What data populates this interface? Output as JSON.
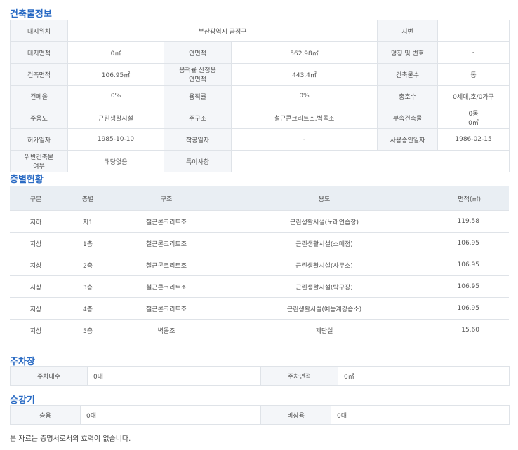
{
  "building": {
    "title": "건축물정보",
    "rows": [
      [
        {
          "l": "대지위치"
        },
        {
          "v": "부산광역시 금정구",
          "span": 3
        },
        {
          "l": "지번"
        },
        {
          "v": ""
        }
      ],
      [
        {
          "l": "대지면적"
        },
        {
          "v": "0㎡"
        },
        {
          "l": "연면적"
        },
        {
          "v": "562.98㎡"
        },
        {
          "l": "명칭 및 번호"
        },
        {
          "v": "-"
        }
      ],
      [
        {
          "l": "건축면적"
        },
        {
          "v": "106.95㎡"
        },
        {
          "l": "용적률 산정용\n연면적"
        },
        {
          "v": "443.4㎡"
        },
        {
          "l": "건축물수"
        },
        {
          "v": "동"
        }
      ],
      [
        {
          "l": "건폐율"
        },
        {
          "v": "0%"
        },
        {
          "l": "용적률"
        },
        {
          "v": "0%"
        },
        {
          "l": "총호수"
        },
        {
          "v": "0세대,호/0가구"
        }
      ],
      [
        {
          "l": "주용도"
        },
        {
          "v": "근린생활시설"
        },
        {
          "l": "주구조"
        },
        {
          "v": "철근콘크리트조,벽돌조"
        },
        {
          "l": "부속건축물"
        },
        {
          "v": "0동\n0㎡"
        }
      ],
      [
        {
          "l": "허가일자"
        },
        {
          "v": "1985-10-10"
        },
        {
          "l": "착공일자"
        },
        {
          "v": "-"
        },
        {
          "l": "사용승인일자"
        },
        {
          "v": "1986-02-15"
        }
      ],
      [
        {
          "l": "위반건축물\n여부"
        },
        {
          "v": "해당없음"
        },
        {
          "l": "특이사항"
        },
        {
          "v": "",
          "span": 3
        }
      ]
    ]
  },
  "floors": {
    "title": "층별현황",
    "headers": [
      "구분",
      "층별",
      "구조",
      "용도",
      "면적(㎡)"
    ],
    "rows": [
      [
        "지하",
        "지1",
        "철근콘크리트조",
        "근린생활시설(노래연습장)",
        "119.58"
      ],
      [
        "지상",
        "1층",
        "철근콘크리트조",
        "근린생활시설(소매점)",
        "106.95"
      ],
      [
        "지상",
        "2층",
        "철근콘크리트조",
        "근린생활시설(사무소)",
        "106.95"
      ],
      [
        "지상",
        "3층",
        "철근콘크리트조",
        "근린생활시설(탁구장)",
        "106.95"
      ],
      [
        "지상",
        "4층",
        "철근콘크리트조",
        "근린생활시설(예능계강습소)",
        "106.95"
      ],
      [
        "지상",
        "5층",
        "벽돌조",
        "계단실",
        "15.60"
      ]
    ]
  },
  "parking": {
    "title": "주차장",
    "count_label": "주차대수",
    "count": "0대",
    "area_label": "주차면적",
    "area": "0㎡"
  },
  "elevator": {
    "title": "승강기",
    "passenger_label": "승용",
    "passenger": "0대",
    "emergency_label": "비상용",
    "emergency": "0대"
  },
  "footnote": "본 자료는 증명서로서의 효력이 없습니다."
}
